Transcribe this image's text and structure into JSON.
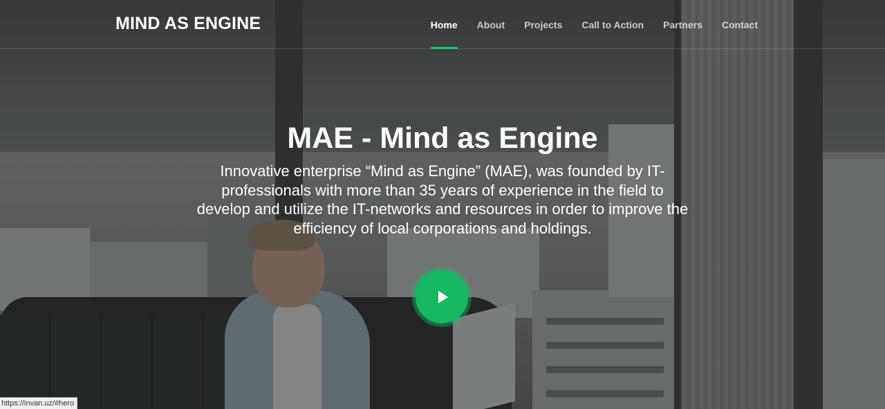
{
  "header": {
    "logo": "MIND AS ENGINE",
    "nav": [
      {
        "label": "Home",
        "active": true
      },
      {
        "label": "About",
        "active": false
      },
      {
        "label": "Projects",
        "active": false
      },
      {
        "label": "Call to Action",
        "active": false
      },
      {
        "label": "Partners",
        "active": false
      },
      {
        "label": "Contact",
        "active": false
      }
    ]
  },
  "hero": {
    "title": "MAE - Mind as Engine",
    "description": "Innovative enterprise “Mind as Engine” (MAE), was founded by IT-professionals with more than 35 years of experience in the field to develop and utilize the IT-networks and resources in order to improve the efficiency of local corporations and holdings.",
    "play_icon": "play-icon"
  },
  "status_bar": {
    "url": "https://invan.uz/#hero"
  },
  "colors": {
    "accent": "#18c26a",
    "text": "#ffffff"
  }
}
